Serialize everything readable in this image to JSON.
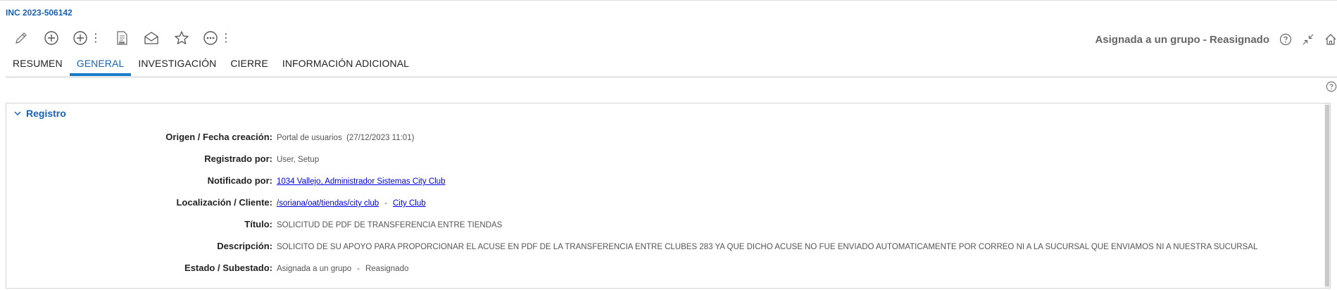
{
  "header": {
    "incident_id": "INC 2023-506142"
  },
  "toolbar": {
    "buttons": [
      {
        "name": "edit",
        "icon": "pencil-icon"
      },
      {
        "name": "add",
        "icon": "plus-circle-icon"
      },
      {
        "name": "add-more",
        "icon": "plus-circle-icon",
        "more": "⋮"
      },
      {
        "name": "pdf",
        "icon": "pdf-document-icon"
      },
      {
        "name": "mail",
        "icon": "envelope-open-icon"
      },
      {
        "name": "favorite",
        "icon": "star-icon"
      },
      {
        "name": "more",
        "icon": "ellipsis-circle-icon",
        "more": "⋮"
      }
    ]
  },
  "status": {
    "text": "Asignada a un grupo - Reasignado",
    "icons": [
      "help-circle-icon",
      "collapse-icon",
      "home-icon"
    ]
  },
  "tabs": [
    {
      "label": "RESUMEN",
      "active": false
    },
    {
      "label": "GENERAL",
      "active": true
    },
    {
      "label": "INVESTIGACIÓN",
      "active": false
    },
    {
      "label": "CIERRE",
      "active": false
    },
    {
      "label": "INFORMACIÓN ADICIONAL",
      "active": false
    }
  ],
  "section": {
    "title": "Registro",
    "fields": {
      "origen": {
        "label": "Origen / Fecha creación:",
        "value": "Portal de usuarios",
        "date": "(27/12/2023 11:01)"
      },
      "registrado": {
        "label": "Registrado por:",
        "value": "User, Setup"
      },
      "notificado": {
        "label": "Notificado por:",
        "link": "1034 Vallejo, Administrador Sistemas City Club"
      },
      "localizacion": {
        "label": "Localización / Cliente:",
        "link": "/soriana/oat/tiendas/city club",
        "separator": "-",
        "link2": "City Club"
      },
      "titulo": {
        "label": "Título:",
        "value": "SOLICITUD DE PDF DE TRANSFERENCIA ENTRE TIENDAS"
      },
      "descripcion": {
        "label": "Descripción:",
        "value": "SOLICITO DE SU APOYO PARA PROPORCIONAR EL ACUSE EN PDF DE LA TRANSFERENCIA ENTRE CLUBES 283 YA QUE DICHO ACUSE NO FUE ENVIADO AUTOMATICAMENTE POR CORREO NI A LA SUCURSAL QUE ENVIAMOS NI A NUESTRA SUCURSAL"
      },
      "estado": {
        "label": "Estado / Subestado:",
        "value": "Asignada a un grupo",
        "separator": "-",
        "value2": "Reasignado"
      }
    }
  },
  "colors": {
    "accent": "#1a62b6",
    "tab_underline": "#1a7cc9",
    "link": "#0000ee",
    "status_text": "#666666"
  }
}
